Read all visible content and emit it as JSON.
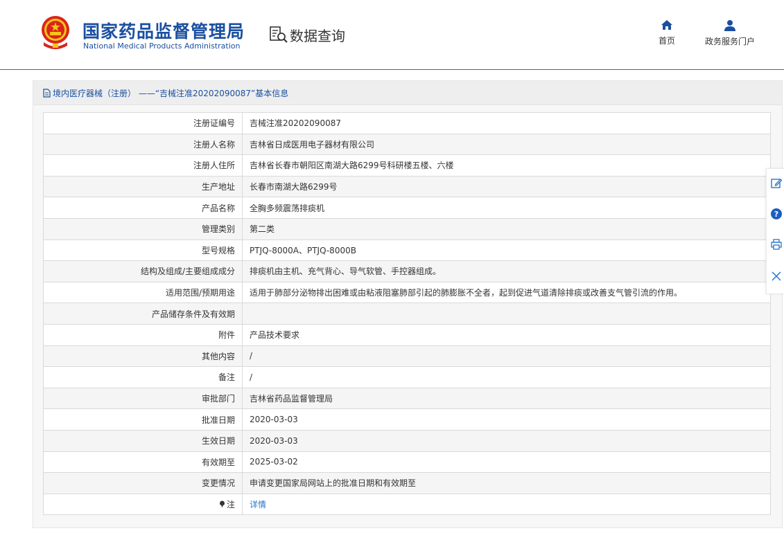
{
  "header": {
    "brand_cn": "国家药品监督管理局",
    "brand_en": "National Medical Products Administration",
    "query_title": "数据查询",
    "nav": [
      {
        "label": "首页",
        "icon": "home-icon"
      },
      {
        "label": "政务服务门户",
        "icon": "user-icon"
      }
    ]
  },
  "panel": {
    "title": "境内医疗器械（注册） ——“吉械注准20202090087”基本信息"
  },
  "table": {
    "rows": [
      {
        "key": "注册证编号",
        "value": "吉械注准20202090087"
      },
      {
        "key": "注册人名称",
        "value": "吉林省日成医用电子器材有限公司"
      },
      {
        "key": "注册人住所",
        "value": "吉林省长春市朝阳区南湖大路6299号科研楼五楼、六楼"
      },
      {
        "key": "生产地址",
        "value": "长春市南湖大路6299号"
      },
      {
        "key": "产品名称",
        "value": "全胸多频震荡排痰机"
      },
      {
        "key": "管理类别",
        "value": "第二类"
      },
      {
        "key": "型号规格",
        "value": "PTJQ-8000A、PTJQ-8000B"
      },
      {
        "key": "结构及组成/主要组成成分",
        "value": "排痰机由主机、充气背心、导气软管、手控器组成。"
      },
      {
        "key": "适用范围/预期用途",
        "value": "适用于肺部分泌物排出困难或由粘液阻塞肺部引起的肺膨胀不全者，起到促进气道清除排痰或改善支气管引流的作用。"
      },
      {
        "key": "产品储存条件及有效期",
        "value": ""
      },
      {
        "key": "附件",
        "value": "产品技术要求"
      },
      {
        "key": "其他内容",
        "value": "/"
      },
      {
        "key": "备注",
        "value": "/"
      },
      {
        "key": "审批部门",
        "value": "吉林省药品监督管理局"
      },
      {
        "key": "批准日期",
        "value": "2020-03-03"
      },
      {
        "key": "生效日期",
        "value": "2020-03-03"
      },
      {
        "key": "有效期至",
        "value": "2025-03-02"
      },
      {
        "key": "变更情况",
        "value": "申请变更国家局网站上的批准日期和有效期至"
      }
    ],
    "note_row": {
      "key": "注",
      "value": "详情"
    }
  },
  "toolbar": [
    "edit-icon",
    "help-icon",
    "print-icon",
    "close-icon"
  ],
  "colors": {
    "brand": "#1a4fa0",
    "link": "#2a73c9",
    "header_rule": "#2c6bbd"
  }
}
